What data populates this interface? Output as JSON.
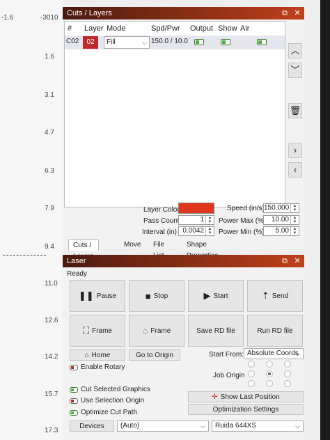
{
  "ruler": {
    "top_left": "-1.6",
    "top_right": "-3010",
    "ticks": [
      "1.6",
      "3.1",
      "4.7",
      "6.3",
      "7.9",
      "9.4",
      "11.0",
      "12.6",
      "14.2",
      "15.7",
      "17.3"
    ]
  },
  "cuts_panel": {
    "title": "Cuts / Layers",
    "float_icon": "restore-icon",
    "close_icon": "close-icon",
    "columns": [
      "#",
      "Layer",
      "Mode",
      "Spd/Pwr",
      "Output",
      "Show",
      "Air"
    ],
    "rows": [
      {
        "num": "C02",
        "layer": "02",
        "mode": "Fill",
        "spd_pwr": "150.0 / 10.0",
        "output": true,
        "show": true,
        "air": true
      }
    ],
    "side_buttons": [
      "chevron-up-icon",
      "chevron-down-icon",
      "trash-icon",
      "chevron-right-icon",
      "chevron-left-icon"
    ],
    "layer_color_label": "Layer Color",
    "layer_color": "#e0371c",
    "pass_count_label": "Pass Count",
    "pass_count": "1",
    "interval_label": "Interval (in)",
    "interval": "0.0042",
    "speed_label": "Speed (in/s)",
    "speed": "150.000",
    "power_max_label": "Power Max (%)",
    "power_max": "10.00",
    "power_min_label": "Power Min (%)",
    "power_min": "5.00",
    "tabs": [
      "Cuts / Layers",
      "Move",
      "File List",
      "Shape Properties"
    ]
  },
  "laser_panel": {
    "title": "Laser",
    "status": "Ready",
    "buttons": {
      "pause": "Pause",
      "stop": "Stop",
      "start": "Start",
      "send": "Send",
      "frame1": "Frame",
      "frame2": "Frame",
      "save_rd": "Save RD file",
      "run_rd": "Run RD file",
      "home": "Home",
      "go_to_origin": "Go to Origin",
      "show_last_position": "Show Last Position",
      "optimization_settings": "Optimization Settings",
      "devices": "Devices"
    },
    "start_from_label": "Start From:",
    "start_from_value": "Absolute Coords",
    "job_origin_label": "Job Origin",
    "enable_rotary": "Enable Rotary",
    "cut_selected": "Cut Selected Graphics",
    "use_selection_origin": "Use Selection Origin",
    "optimize_cut_path": "Optimize Cut Path",
    "port_value": "(Auto)",
    "device_value": "Ruida 644XS"
  },
  "colors": {
    "title_gradient_start": "#4a1a10",
    "title_gradient_end": "#c0401a",
    "layer_chip": "#c0282c",
    "toggle_on": "#4cae3a"
  }
}
